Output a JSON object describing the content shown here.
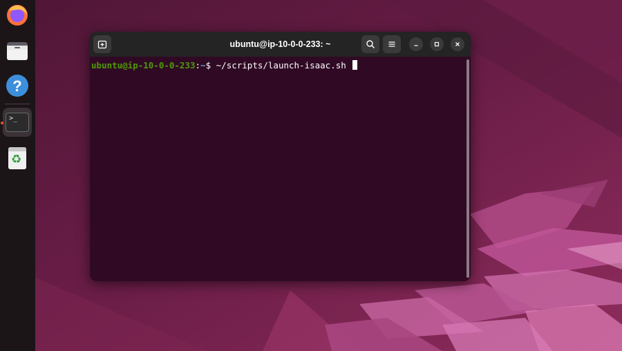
{
  "dock": {
    "items": [
      {
        "name": "firefox",
        "icon": "firefox-icon"
      },
      {
        "name": "files",
        "icon": "folder-icon"
      },
      {
        "name": "help",
        "icon": "help-icon",
        "glyph": "?"
      },
      {
        "name": "terminal",
        "icon": "terminal-icon",
        "glyph": ">_",
        "running": true
      },
      {
        "name": "trash",
        "icon": "trash-icon",
        "glyph": "♻"
      }
    ]
  },
  "terminal": {
    "title": "ubuntu@ip-10-0-0-233: ~",
    "prompt_user": "ubuntu@ip-10-0-0-233",
    "prompt_sep": ":",
    "prompt_path": "~",
    "prompt_symbol": "$",
    "command": "~/scripts/launch-isaac.sh"
  },
  "colors": {
    "accent": "#e95420",
    "terminal_bg": "#300a24",
    "prompt_user": "#4e9a06",
    "prompt_path": "#6d9bd1"
  }
}
